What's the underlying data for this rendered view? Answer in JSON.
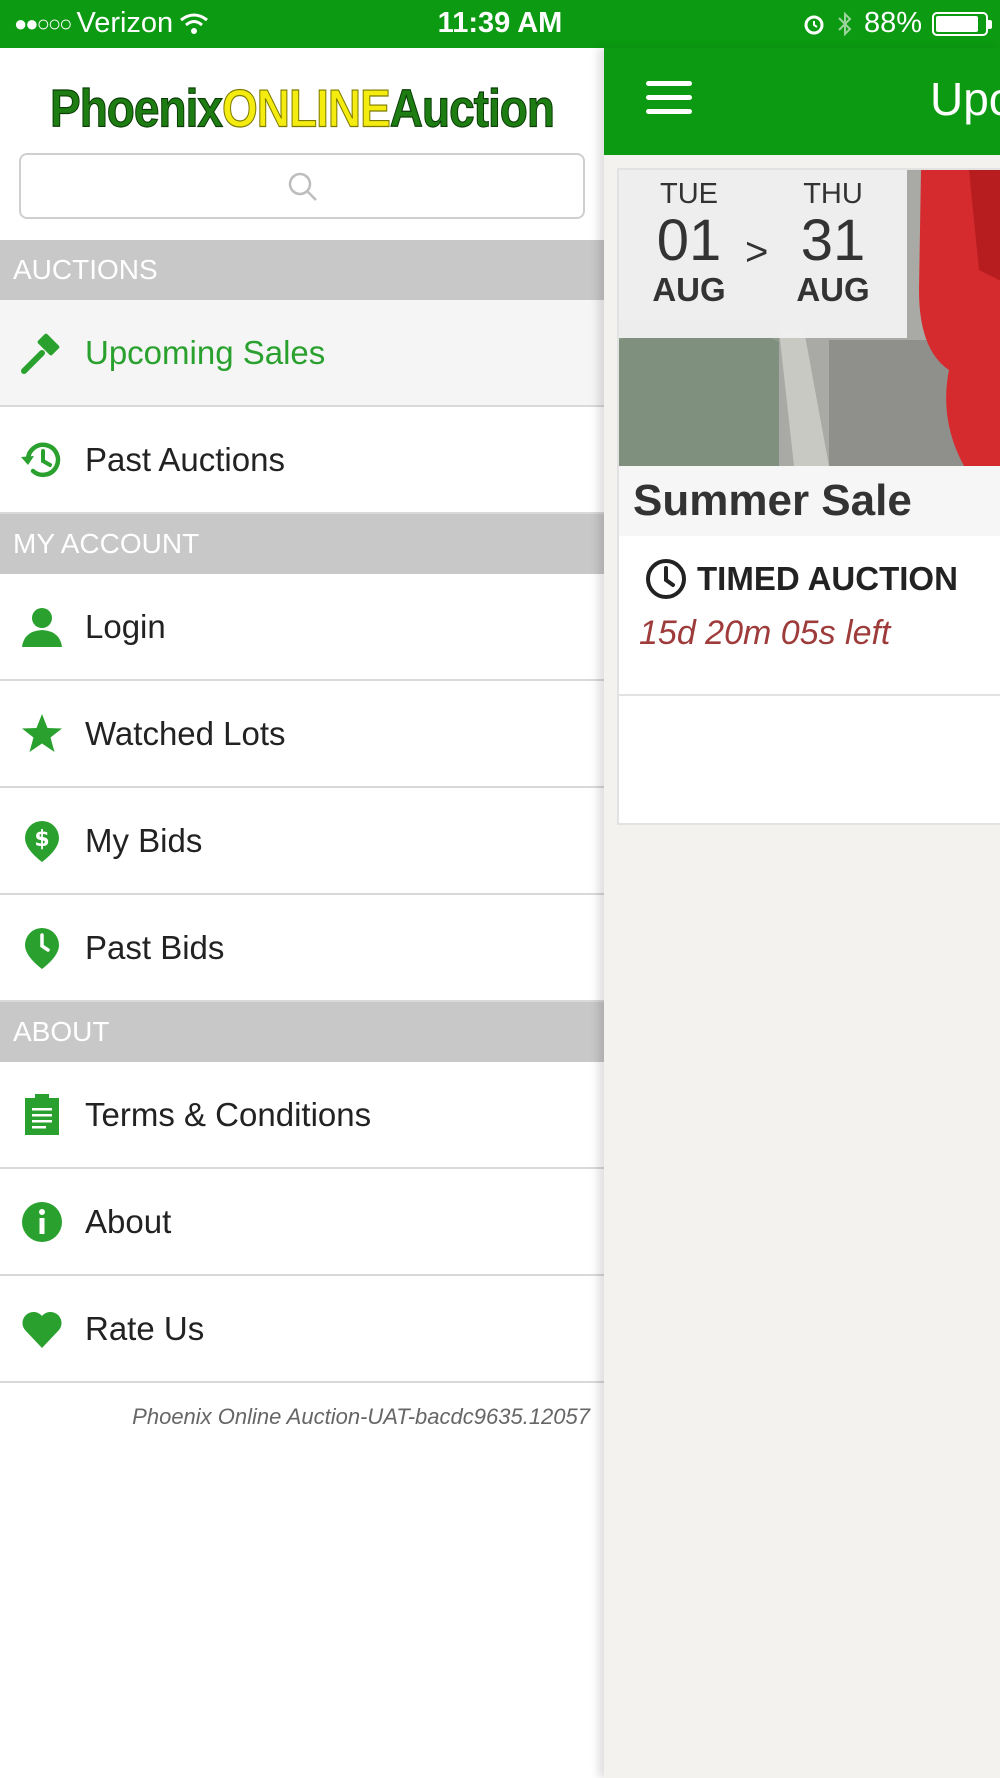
{
  "status_bar": {
    "signal": "●●○○○",
    "carrier": "Verizon",
    "time": "11:39 AM",
    "battery": "88%",
    "battery_level": 0.88
  },
  "drawer": {
    "logo": {
      "part1": "Phoenix",
      "part2": "ONLINE",
      "part3": "Auction"
    },
    "search": {
      "placeholder": ""
    },
    "sections": [
      {
        "title": "AUCTIONS",
        "items": [
          {
            "label": "Upcoming Sales",
            "icon": "gavel-icon",
            "active": true
          },
          {
            "label": "Past Auctions",
            "icon": "history-icon"
          }
        ]
      },
      {
        "title": "MY ACCOUNT",
        "items": [
          {
            "label": "Login",
            "icon": "user-icon"
          },
          {
            "label": "Watched Lots",
            "icon": "star-icon"
          },
          {
            "label": "My Bids",
            "icon": "dollar-pin-icon"
          },
          {
            "label": "Past Bids",
            "icon": "clock-pin-icon"
          }
        ]
      },
      {
        "title": "ABOUT",
        "items": [
          {
            "label": "Terms & Conditions",
            "icon": "clipboard-icon"
          },
          {
            "label": "About",
            "icon": "info-icon"
          },
          {
            "label": "Rate Us",
            "icon": "heart-icon"
          }
        ]
      }
    ],
    "version": "Phoenix Online Auction-UAT-bacdc9635.12057"
  },
  "main": {
    "title": "Upcoming Sales",
    "card": {
      "start": {
        "day": "TUE",
        "date": "01",
        "month": "AUG"
      },
      "arrow": ">",
      "end": {
        "day": "THU",
        "date": "31",
        "month": "AUG"
      },
      "title": "Summer Sale",
      "type": "TIMED AUCTION",
      "time_left": "15d 20m 05s left"
    }
  },
  "colors": {
    "brand_green": "#0b9a11",
    "icon_green": "#2aa12e",
    "section_gray": "#c8c8c8",
    "time_left_red": "#9e3b3b"
  }
}
